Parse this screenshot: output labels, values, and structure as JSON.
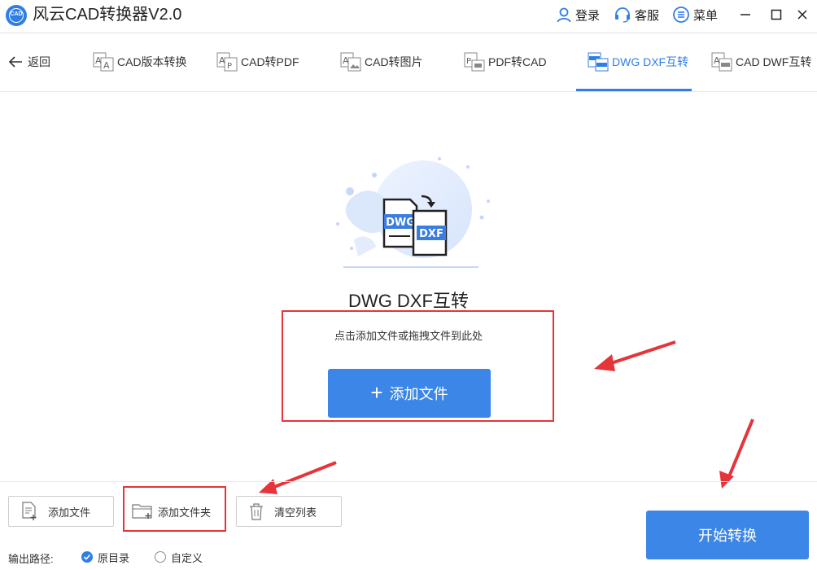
{
  "app": {
    "title": "风云CAD转换器V2.0",
    "logo_text": "CAD"
  },
  "titlebar": {
    "login_label": "登录",
    "service_label": "客服",
    "menu_label": "菜单"
  },
  "nav": {
    "back_label": "返回",
    "tabs": [
      {
        "label": "CAD版本转换"
      },
      {
        "label": "CAD转PDF"
      },
      {
        "label": "CAD转图片"
      },
      {
        "label": "PDF转CAD"
      },
      {
        "label": "DWG DXF互转"
      },
      {
        "label": "CAD DWF互转"
      }
    ],
    "active_tab": 4
  },
  "main": {
    "title": "DWG DXF互转",
    "hint": "点击添加文件或拖拽文件到此处",
    "add_file_label": "添加文件",
    "badge_dwg": "DWG",
    "badge_dxf": "DXF"
  },
  "toolbar": {
    "add_file_label": "添加文件",
    "add_folder_label": "添加文件夹",
    "clear_list_label": "清空列表"
  },
  "output": {
    "label": "输出路径:",
    "options": [
      {
        "label": "原目录",
        "selected": true
      },
      {
        "label": "自定义",
        "selected": false
      }
    ]
  },
  "start_label": "开始转换",
  "colors": {
    "accent": "#3b86e6",
    "annotation": "#e5343a"
  }
}
